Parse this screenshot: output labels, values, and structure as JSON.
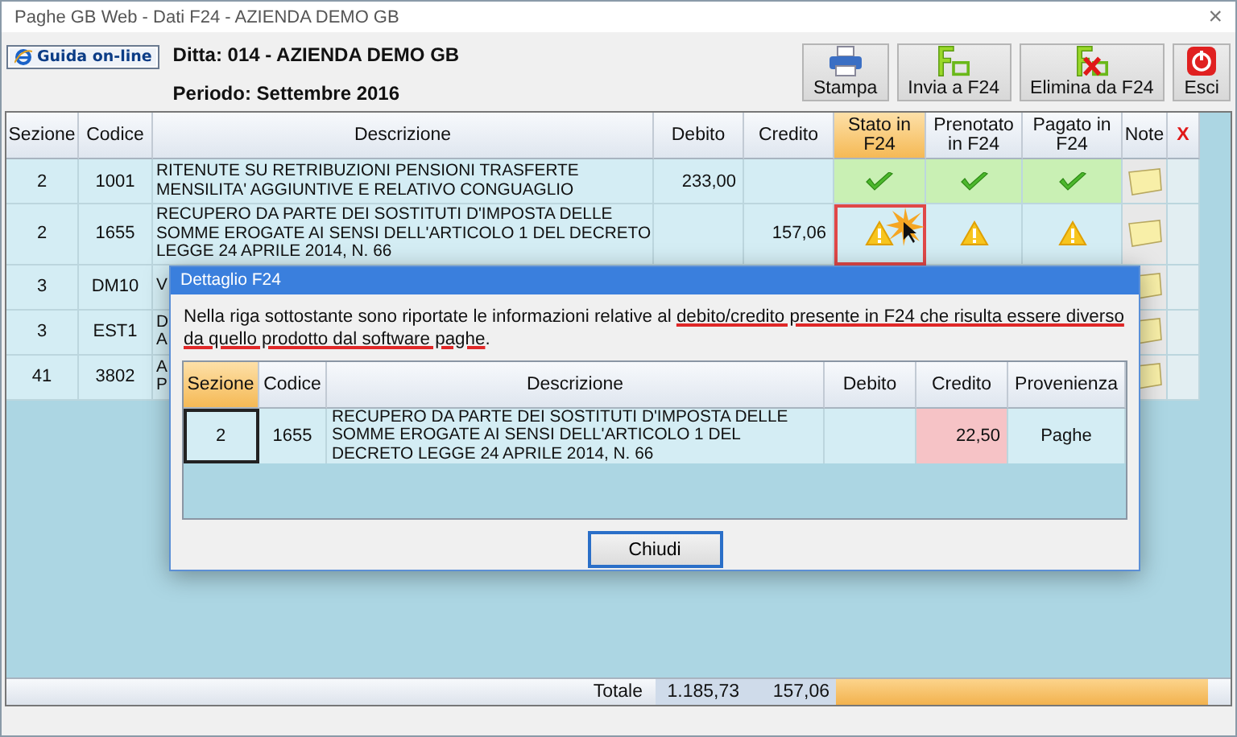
{
  "window": {
    "title": "Paghe GB Web - Dati F24 - AZIENDA DEMO GB",
    "close": "×"
  },
  "header": {
    "help_button": "Guida on-line",
    "company": "Ditta: 014 - AZIENDA DEMO GB",
    "period": "Periodo: Settembre 2016"
  },
  "toolbar": [
    {
      "label": "Stampa",
      "kind": "print"
    },
    {
      "label": "Invia a F24",
      "kind": "send"
    },
    {
      "label": "Elimina da F24",
      "kind": "delete"
    },
    {
      "label": "Esci",
      "kind": "exit"
    }
  ],
  "main_table": {
    "columns": [
      {
        "label": "Sezione",
        "kind": "text",
        "selected": false
      },
      {
        "label": "Codice",
        "kind": "text",
        "selected": false
      },
      {
        "label": "Descrizione",
        "kind": "text",
        "selected": false
      },
      {
        "label": "Debito",
        "kind": "text",
        "selected": false
      },
      {
        "label": "Credito",
        "kind": "text",
        "selected": false
      },
      {
        "label": "Stato in F24",
        "kind": "text",
        "selected": true
      },
      {
        "label": "Prenotato in F24",
        "kind": "text",
        "selected": false
      },
      {
        "label": "Pagato in F24",
        "kind": "text",
        "selected": false
      },
      {
        "label": "Note",
        "kind": "text",
        "selected": false
      },
      {
        "label": "X",
        "kind": "delete",
        "selected": false
      }
    ],
    "rows": [
      {
        "sezione": "2",
        "codice": "1001",
        "descrizione": [
          "RITENUTE SU RETRIBUZIONI  PENSIONI TRASFERTE",
          "MENSILITA' AGGIUNTIVE E RELATIVO CONGUAGLIO"
        ],
        "debito": "233,00",
        "stato_ok": true,
        "prenotato_ok": true,
        "pagato_ok": true,
        "stato_highlighted": false,
        "has_note": true
      },
      {
        "sezione": "2",
        "codice": "1655",
        "descrizione": [
          "RECUPERO DA PARTE DEI SOSTITUTI D'IMPOSTA DELLE",
          "SOMME EROGATE AI SENSI DELL'ARTICOLO 1 DEL DECRETO",
          "LEGGE 24 APRILE 2014, N. 66"
        ],
        "credito": "157,06",
        "stato_ok": false,
        "prenotato_ok": false,
        "pagato_ok": false,
        "stato_highlighted": true,
        "has_note": true
      },
      {
        "sezione": "3",
        "codice": "DM10",
        "descrizione": [
          "V"
        ],
        "stato_highlighted": false,
        "has_note": true
      },
      {
        "sezione": "3",
        "codice": "EST1",
        "descrizione": [
          "D",
          "A"
        ],
        "stato_highlighted": false,
        "has_note": true
      },
      {
        "sezione": "41",
        "codice": "3802",
        "descrizione": [
          "A",
          "P"
        ],
        "stato_highlighted": false,
        "has_note": true
      }
    ],
    "totals": {
      "label": "Totale",
      "debito": "1.185,73",
      "credito": "157,06"
    }
  },
  "dialog": {
    "title": "Dettaglio F24",
    "message": [
      {
        "text": "Nella riga sottostante sono riportate le informazioni relative al ",
        "underlined": false
      },
      {
        "text": "debito/credito presente in F24 che risulta essere diverso da quello prodotto dal software paghe",
        "underlined": true
      },
      {
        "text": ".",
        "underlined": false
      }
    ],
    "columns": [
      {
        "label": "Sezione",
        "selected": true
      },
      {
        "label": "Codice",
        "selected": false
      },
      {
        "label": "Descrizione",
        "selected": false
      },
      {
        "label": "Debito",
        "selected": false
      },
      {
        "label": "Credito",
        "selected": false
      },
      {
        "label": "Provenienza",
        "selected": false
      }
    ],
    "rows": [
      {
        "cells": [
          {
            "text": "2",
            "focused": true,
            "highlighted": false
          },
          {
            "text": "1655",
            "focused": false,
            "highlighted": false
          },
          {
            "text": "RECUPERO DA PARTE DEI SOSTITUTI D'IMPOSTA DELLE SOMME EROGATE AI SENSI DELL'ARTICOLO 1 DEL DECRETO LEGGE 24 APRILE 2014, N. 66",
            "focused": false,
            "highlighted": false
          },
          {
            "focused": false,
            "highlighted": false
          },
          {
            "text": "22,50",
            "focused": false,
            "highlighted": true
          },
          {
            "text": "Paghe",
            "focused": false,
            "highlighted": false
          }
        ]
      }
    ],
    "button": "Chiudi"
  }
}
